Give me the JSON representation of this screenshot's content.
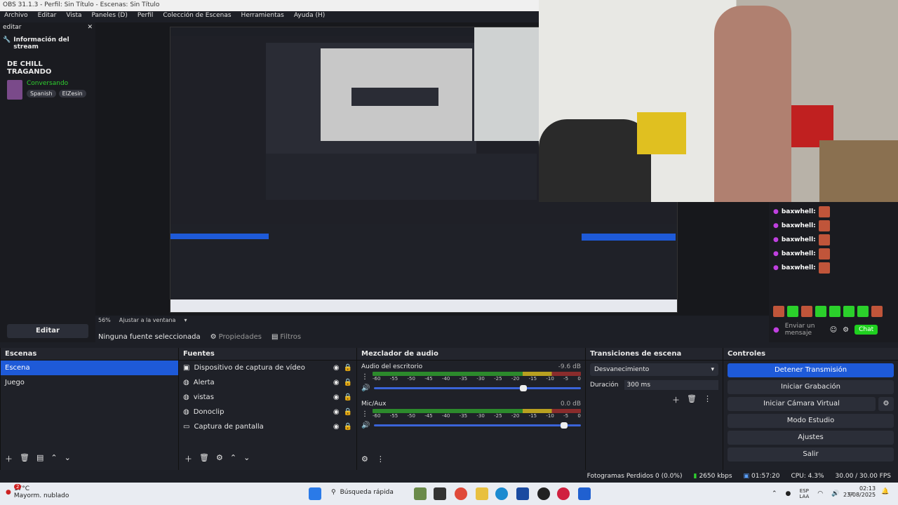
{
  "window": {
    "title": "OBS 31.1.3 - Perfil: Sin Título - Escenas: Sin Título"
  },
  "menu": {
    "items": [
      "Archivo",
      "Editar",
      "Vista",
      "Paneles (D)",
      "Perfil",
      "Colección de Escenas",
      "Herramientas",
      "Ayuda (H)"
    ]
  },
  "dock_left": {
    "tab": "editar",
    "section_title": "Información del stream",
    "stream_title": "DE CHILL TRAGANDO",
    "category": "Conversando",
    "tags": [
      "Spanish",
      "ElZesin"
    ],
    "edit_button": "Editar"
  },
  "preview": {
    "zoom": "56%",
    "fit_label": "Ajustar a la ventana"
  },
  "source_toolbar": {
    "no_source": "Ninguna fuente seleccionada",
    "properties": "Propiedades",
    "filters": "Filtros"
  },
  "chat": {
    "users": [
      {
        "name": "baxwhell:"
      },
      {
        "name": "baxwhell:"
      },
      {
        "name": "baxwhell:"
      },
      {
        "name": "baxwhell:"
      },
      {
        "name": "baxwhell:"
      }
    ],
    "input_placeholder": "Enviar un mensaje",
    "chat_button": "Chat"
  },
  "scenes": {
    "title": "Escenas",
    "items": [
      "Escena",
      "Juego"
    ],
    "selected": 0
  },
  "sources": {
    "title": "Fuentes",
    "items": [
      "Dispositivo de captura de vídeo",
      "Alerta",
      "vistas",
      "Donoclip",
      "Captura de pantalla"
    ]
  },
  "mixer": {
    "title": "Mezclador de audio",
    "channels": [
      {
        "name": "Audio del escritorio",
        "db": "-9.6 dB",
        "level": 0.72
      },
      {
        "name": "Mic/Aux",
        "db": "0.0 dB",
        "level": 0.92
      }
    ],
    "ticks": [
      "-60",
      "-55",
      "-50",
      "-45",
      "-40",
      "-35",
      "-30",
      "-25",
      "-20",
      "-15",
      "-10",
      "-5",
      "0"
    ]
  },
  "transitions": {
    "title": "Transiciones de escena",
    "selected": "Desvanecimiento",
    "duration_label": "Duración",
    "duration_value": "300 ms"
  },
  "controls": {
    "title": "Controles",
    "buttons": [
      "Detener Transmisión",
      "Iniciar Grabación",
      "Iniciar Cámara Virtual",
      "Modo Estudio",
      "Ajustes",
      "Salir"
    ]
  },
  "status": {
    "dropped": "Fotogramas Perdidos 0 (0.0%)",
    "bitrate": "2650 kbps",
    "time": "01:57:20",
    "cpu": "CPU: 4.3%",
    "fps": "30.00 / 30.00 FPS"
  },
  "taskbar": {
    "weather_temp": "17°C",
    "weather_desc": "Mayorm. nublado",
    "search": "Búsqueda rápida",
    "lang1": "ESP",
    "lang2": "LAA",
    "time": "02:13",
    "date": "23/08/2025",
    "badge": "2"
  },
  "colors": {
    "accent": "#1e5ad8",
    "chat_green": "#1fd01f",
    "meter_green": "#2c8a2c"
  }
}
